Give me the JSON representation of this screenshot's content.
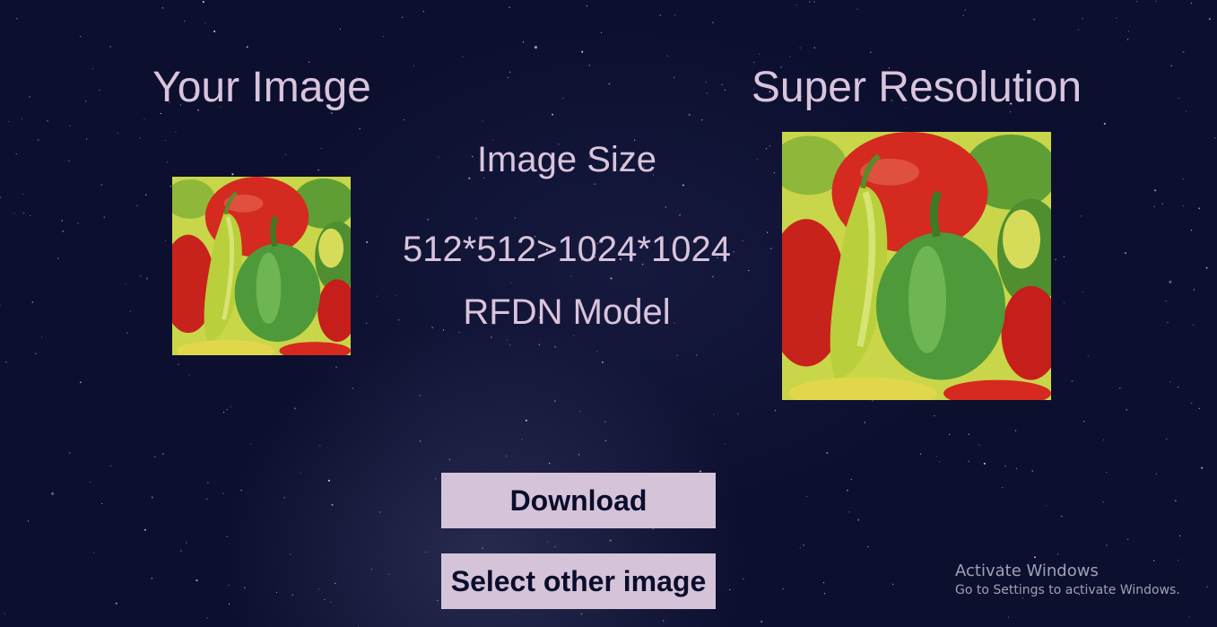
{
  "left_panel": {
    "title": "Your Image"
  },
  "right_panel": {
    "title": "Super Resolution"
  },
  "info": {
    "size_label": "Image Size",
    "size_value": "512*512>1024*1024",
    "model_label": "RFDN Model"
  },
  "buttons": {
    "download_label": "Download",
    "select_other_label": "Select other image"
  },
  "activation_watermark": {
    "line1": "Activate Windows",
    "line2": "Go to Settings to activate Windows."
  },
  "images": {
    "input": "peppers-photo",
    "output": "peppers-photo-upscaled"
  },
  "colors": {
    "background": "#0c0f2e",
    "text": "#d9c4dc",
    "button_bg": "#d5c3d9",
    "button_text": "#0b0d2c"
  }
}
